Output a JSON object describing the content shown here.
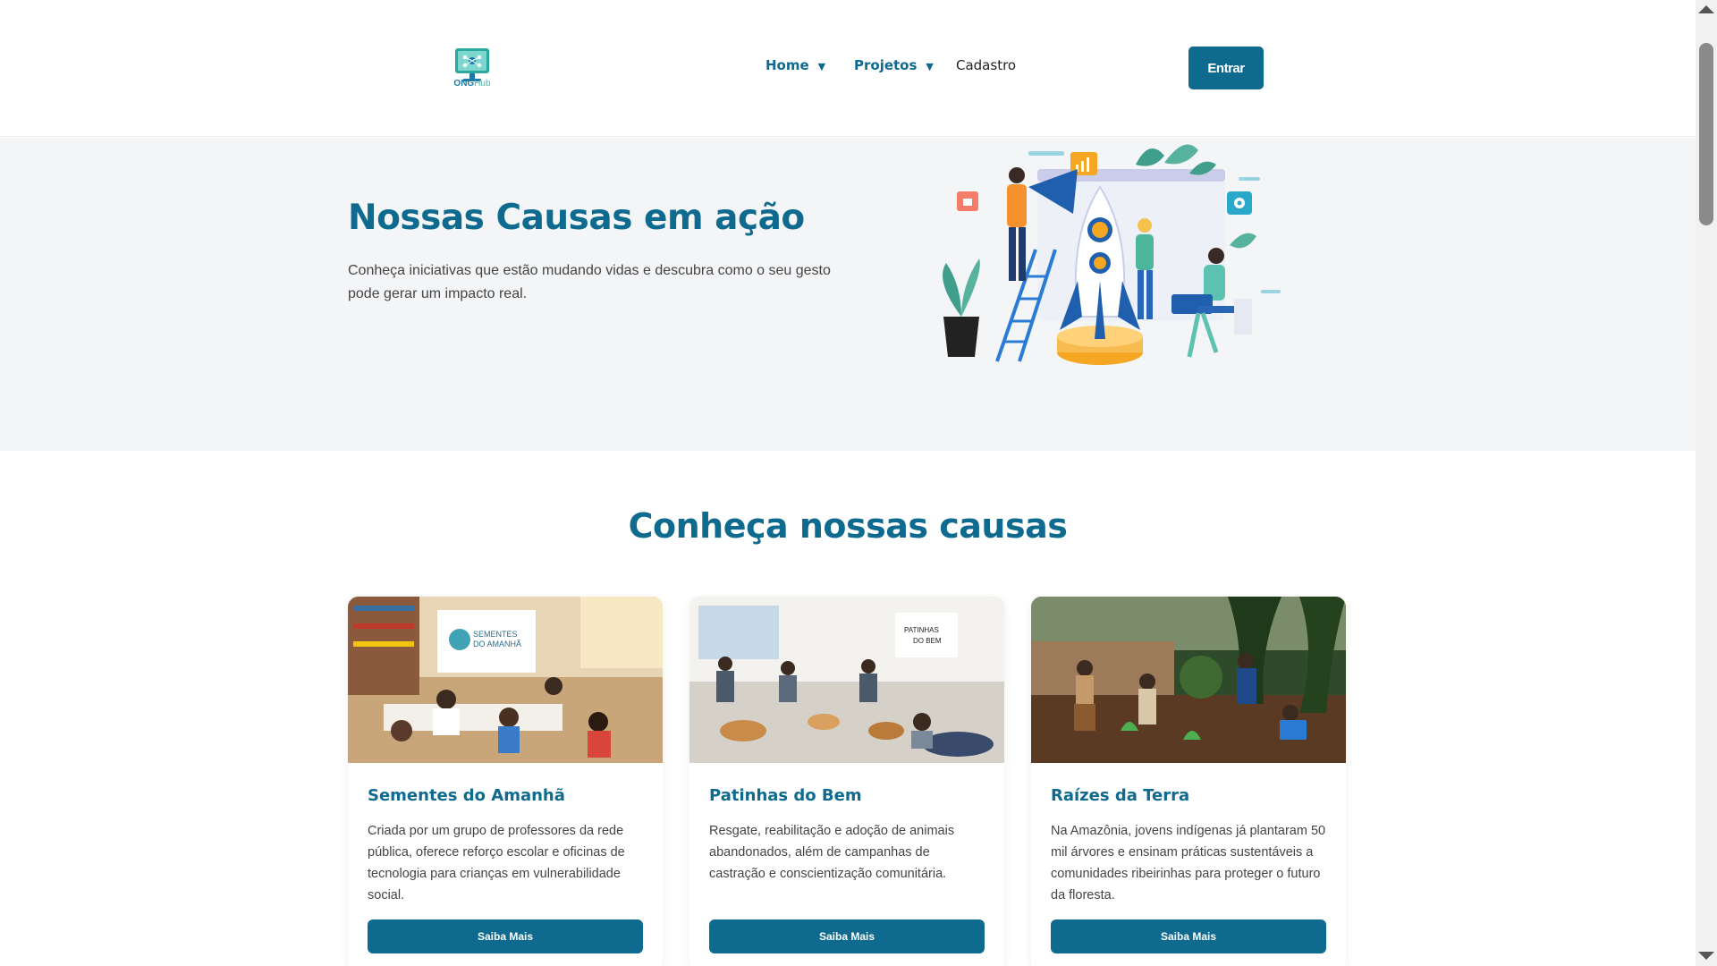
{
  "header": {
    "logo_text_main": "ONG",
    "logo_text_accent": "Hub",
    "nav": {
      "home_label": "Home",
      "projetos_label": "Projetos",
      "cadastro_label": "Cadastro",
      "caret": "▼"
    },
    "entrar_label": "Entrar"
  },
  "hero": {
    "title": "Nossas Causas em ação",
    "text": "Conheça iniciativas que estão mudando vidas e descubra como o seu gesto pode gerar um impacto real."
  },
  "section": {
    "title": "Conheça nossas causas"
  },
  "cards": [
    {
      "title": "Sementes do Amanhã",
      "description": "Criada por um grupo de professores da rede pública, oferece reforço escolar e oficinas de tecnologia para crianças em vulnerabilidade social.",
      "button_label": "Saiba Mais",
      "banner_text": "SEMENTES DO AMANHÃ"
    },
    {
      "title": "Patinhas do Bem",
      "description": "Resgate, reabilitação e adoção de animais abandonados, além de campanhas de castração e conscientização comunitária.",
      "button_label": "Saiba Mais",
      "banner_text": "PATINHAS DO BEM"
    },
    {
      "title": "Raízes da Terra",
      "description": "Na Amazônia, jovens indígenas já plantaram 50 mil árvores e ensinam práticas sustentáveis a comunidades ribeirinhas para proteger o futuro da floresta.",
      "button_label": "Saiba Mais"
    }
  ],
  "colors": {
    "primary": "#0f6a8f",
    "hero_bg": "#f4f5f7"
  }
}
